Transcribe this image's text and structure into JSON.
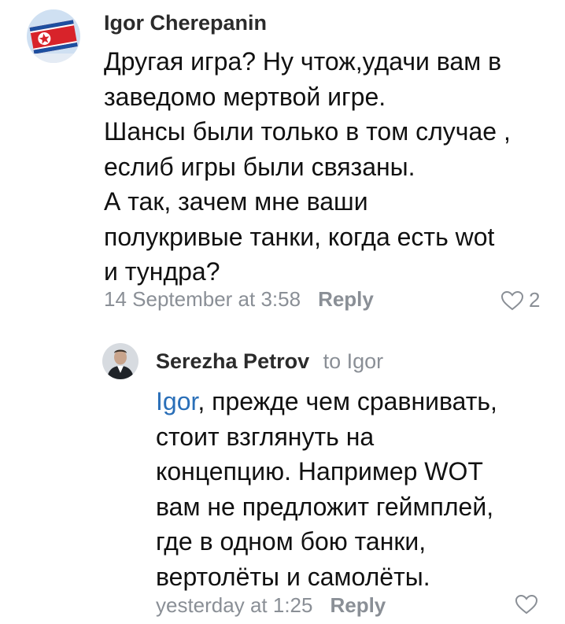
{
  "comment": {
    "author": "Igor Cherepanin",
    "lines": [
      "Другая игра? Ну чтож,удачи вам в",
      "заведомо мертвой игре.",
      "Шансы были только в том случае ,",
      "еслиб игры были связаны.",
      "А так, зачем мне ваши",
      "полукривые танки, когда есть wot",
      "и тундра?"
    ],
    "timestamp": "14 September at 3:58",
    "reply_label": "Reply",
    "likes": "2",
    "avatar_icon": "flag-avatar-icon"
  },
  "reply": {
    "author": "Serezha Petrov",
    "to_label": "to Igor",
    "mention": "Igor",
    "first_line_rest": ", прежде чем сравнивать,",
    "lines": [
      "стоит взглянуть на",
      "концепцию. Например WOT",
      "вам не предложит геймплей,",
      "где в одном бою танки,",
      "вертолёты и самолёты."
    ],
    "timestamp": "yesterday at 1:25",
    "reply_label": "Reply",
    "avatar_icon": "person-avatar-icon"
  },
  "colors": {
    "link": "#2a6fb8",
    "meta": "#8a8f96"
  }
}
